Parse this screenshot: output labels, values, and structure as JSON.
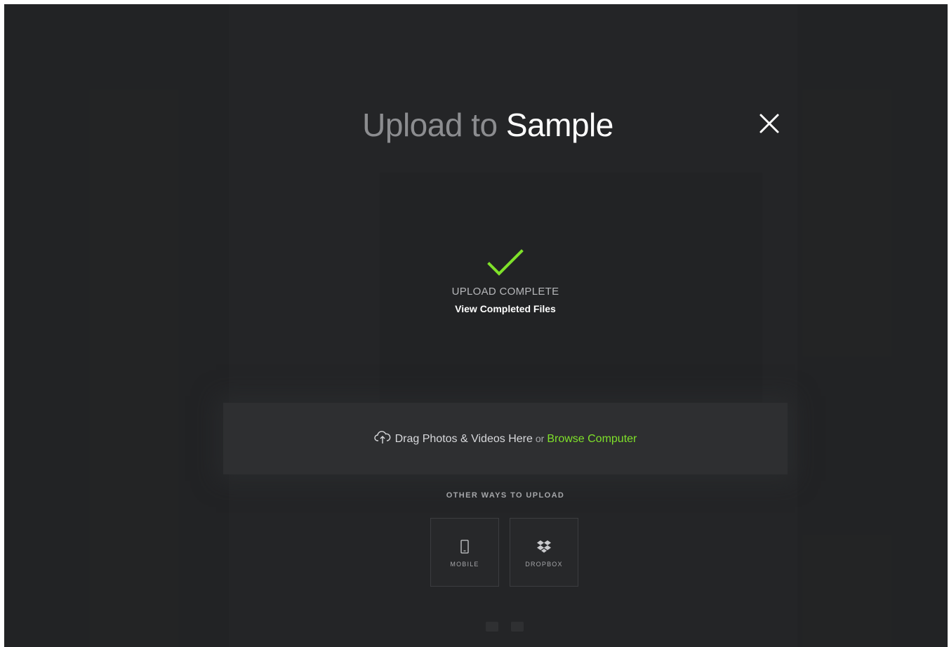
{
  "modal": {
    "title_prefix": "Upload to",
    "title_target": "Sample",
    "close_icon": "close-icon"
  },
  "status": {
    "icon": "check-icon",
    "label": "UPLOAD COMPLETE",
    "link": "View Completed Files"
  },
  "dropzone": {
    "icon": "cloud-upload-icon",
    "drag_text": "Drag Photos & Videos Here",
    "or_text": "or",
    "browse_text": "Browse Computer"
  },
  "other_ways": {
    "heading": "OTHER WAYS TO UPLOAD",
    "options": [
      {
        "label": "MOBILE",
        "icon": "mobile-icon"
      },
      {
        "label": "DROPBOX",
        "icon": "dropbox-icon"
      }
    ]
  },
  "colors": {
    "background": "#242527",
    "accent": "#7fe12a",
    "dropzone": "#2e2f31"
  }
}
